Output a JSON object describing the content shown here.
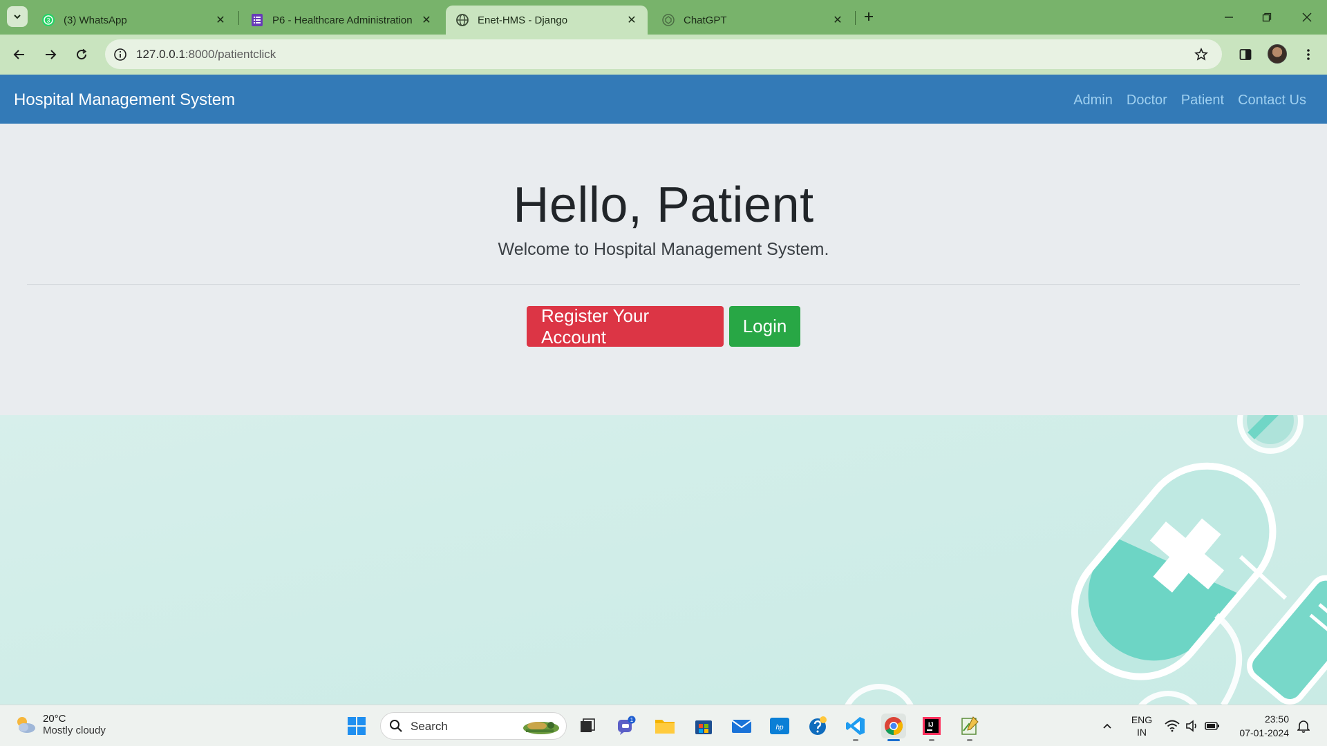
{
  "browser": {
    "tabs": [
      {
        "title": "(3) WhatsApp",
        "active": false
      },
      {
        "title": "P6 - Healthcare Administration",
        "active": false
      },
      {
        "title": "Enet-HMS - Django",
        "active": true
      },
      {
        "title": "ChatGPT",
        "active": false
      }
    ],
    "whatsapp_badge": "3",
    "url_host": "127.0.0.1",
    "url_rest": ":8000/patientclick"
  },
  "site": {
    "brand": "Hospital Management System",
    "nav": [
      "Admin",
      "Doctor",
      "Patient",
      "Contact Us"
    ]
  },
  "hero": {
    "heading": "Hello, Patient",
    "subheading": "Welcome to Hospital Management System.",
    "register_label": "Register Your Account",
    "login_label": "Login"
  },
  "taskbar": {
    "weather_temp": "20°C",
    "weather_desc": "Mostly cloudy",
    "search_label": "Search",
    "teams_badge": "1",
    "lang_1": "ENG",
    "lang_2": "IN",
    "time": "23:50",
    "date": "07-01-2024"
  },
  "colors": {
    "navbar": "#337ab7",
    "register": "#dc3545",
    "login": "#28a745",
    "tabstrip": "#78b36b"
  }
}
